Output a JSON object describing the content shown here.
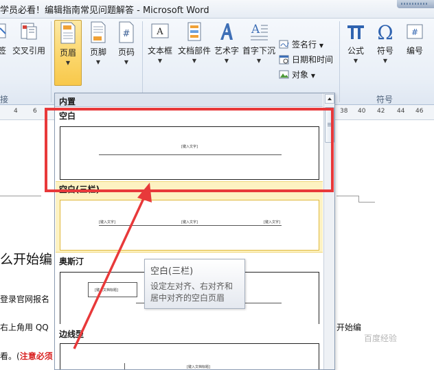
{
  "window": {
    "title": "学员必看！编辑指南常见问题解答 - Microsoft Word"
  },
  "ribbon": {
    "cross_ref": "交叉引用",
    "left_fragment": "签",
    "left_group_fragment": "接",
    "header": "页眉",
    "footer": "页脚",
    "page_number": "页码",
    "textbox": "文本框",
    "quick_parts": "文档部件",
    "wordart": "艺术字",
    "drop_cap": "首字下沉",
    "signature_line": "签名行",
    "date_time": "日期和时间",
    "object": "对象",
    "equation": "公式",
    "symbol": "符号",
    "number": "编号",
    "symbols_group": "符号"
  },
  "ruler": {
    "ticks_left": [
      "4",
      "6"
    ],
    "ticks_right": [
      "38",
      "40",
      "42",
      "44",
      "46"
    ]
  },
  "document": {
    "heading_fragment": "么开始编",
    "line1_fragment": "登录官网报名",
    "line2_fragment": "右上角用 QQ",
    "line2_right_fragment": "开始编",
    "line3_prefix": "看。(",
    "line3_red": "注意必须"
  },
  "gallery": {
    "section": "内置",
    "items": [
      {
        "name": "空白",
        "placeholders": [
          "[键入文字]"
        ]
      },
      {
        "name": "空白(三栏)",
        "placeholders": [
          "[键入文字]",
          "[键入文字]",
          "[键入文字]"
        ]
      },
      {
        "name": "奥斯汀",
        "placeholders": [
          "[键入文档标题]"
        ]
      },
      {
        "name": "边线型",
        "placeholders": [
          "[键入文档标题]"
        ]
      }
    ]
  },
  "tooltip": {
    "title": "空白(三栏)",
    "description": "设定左对齐、右对齐和居中对齐的空白页眉"
  },
  "watermark": "百度经验",
  "colors": {
    "highlight": "#e8393a",
    "active_button": "#fbd568",
    "hover_item": "#fdf2c2"
  }
}
